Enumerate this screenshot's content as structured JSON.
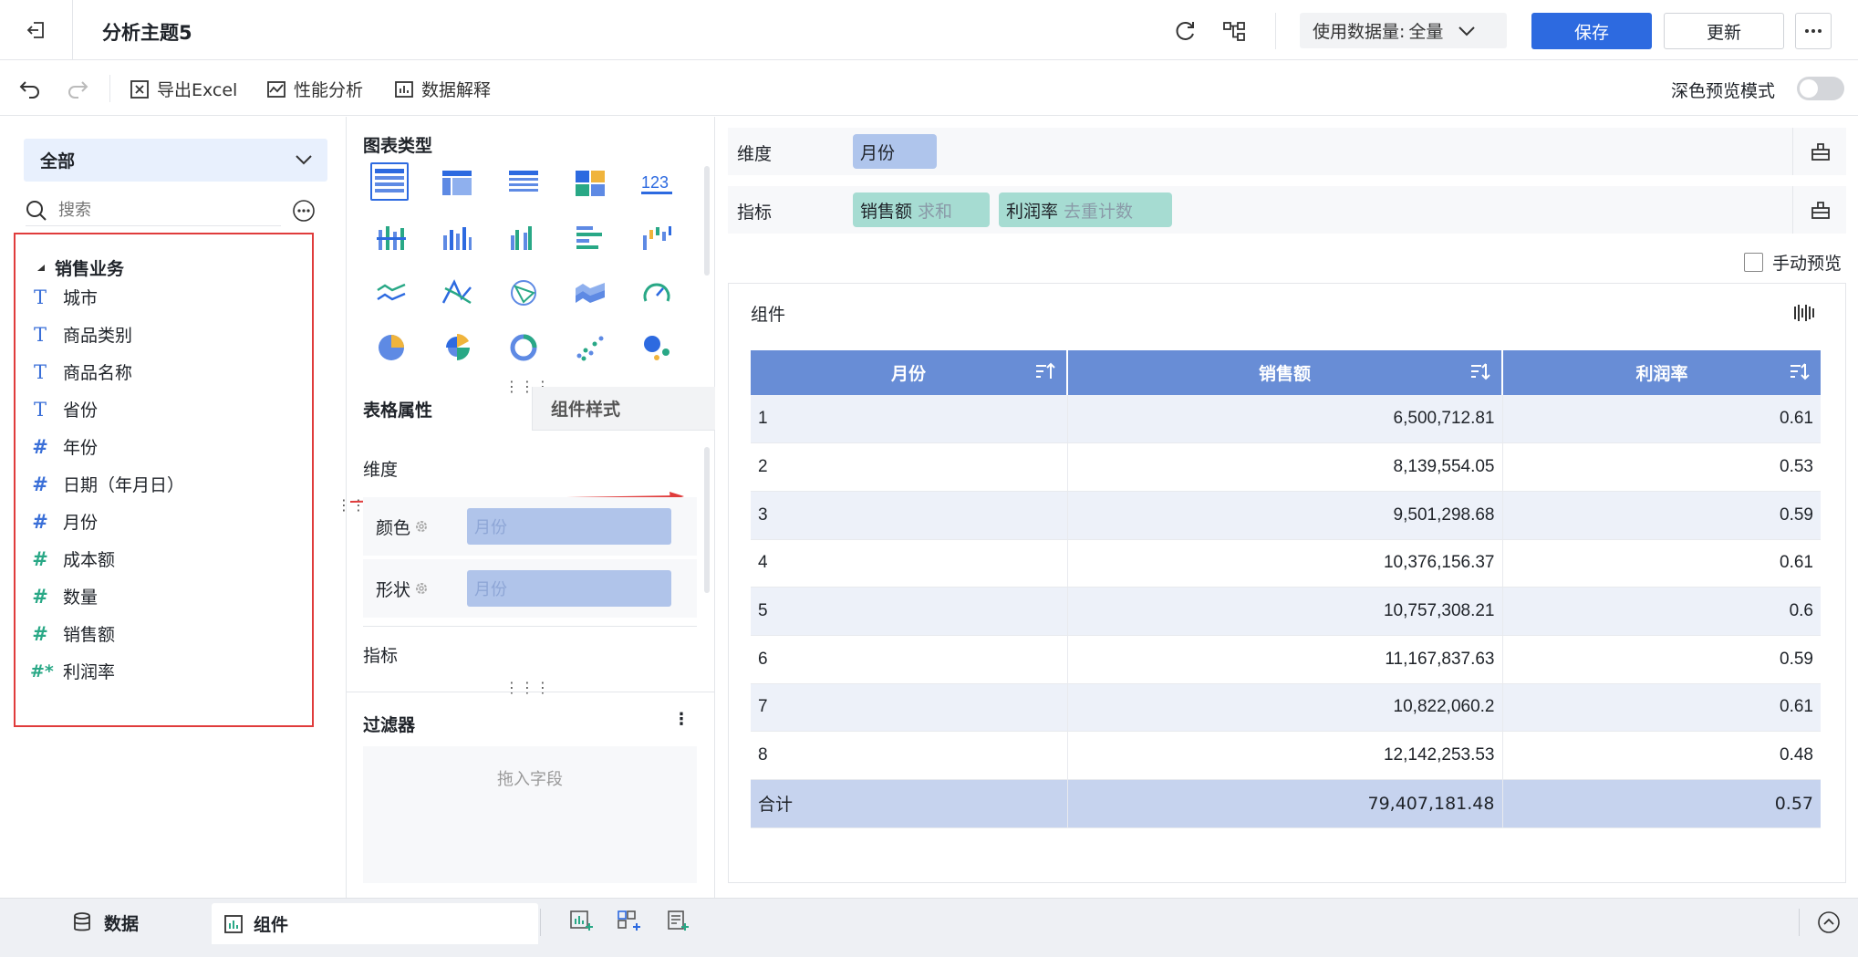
{
  "topbar": {
    "title": "分析主题5",
    "data_volume_label": "使用数据量:",
    "data_volume_value": "全量",
    "save_label": "保存",
    "update_label": "更新"
  },
  "toolbar": {
    "export_label": "导出Excel",
    "perf_label": "性能分析",
    "explain_label": "数据解释",
    "dark_mode_label": "深色预览模式",
    "dark_mode_on": false
  },
  "left": {
    "scope": "全部",
    "search_placeholder": "搜索",
    "group": "销售业务",
    "fields": [
      {
        "label": "城市",
        "type": "text",
        "icon": "text-field-icon"
      },
      {
        "label": "商品类别",
        "type": "text",
        "icon": "text-field-icon"
      },
      {
        "label": "商品名称",
        "type": "text",
        "icon": "text-field-icon"
      },
      {
        "label": "省份",
        "type": "text",
        "icon": "text-field-icon"
      },
      {
        "label": "年份",
        "type": "dim-number",
        "icon": "number-field-icon"
      },
      {
        "label": "日期（年月日）",
        "type": "dim-number",
        "icon": "number-field-icon"
      },
      {
        "label": "月份",
        "type": "dim-number",
        "icon": "number-field-icon"
      },
      {
        "label": "成本额",
        "type": "metric",
        "icon": "number-field-icon"
      },
      {
        "label": "数量",
        "type": "metric",
        "icon": "number-field-icon"
      },
      {
        "label": "销售额",
        "type": "metric",
        "icon": "number-field-icon"
      },
      {
        "label": "利润率",
        "type": "calc-metric",
        "icon": "calculated-field-icon"
      }
    ]
  },
  "middle": {
    "chart_type_title": "图表类型",
    "tab_table": "表格属性",
    "tab_style": "组件样式",
    "dimension_label": "维度",
    "color_label": "颜色",
    "color_value": "月份",
    "shape_label": "形状",
    "shape_value": "月份",
    "metric_label": "指标",
    "filter_title": "过滤器",
    "filter_placeholder": "拖入字段"
  },
  "right": {
    "dim_bar_label": "维度",
    "dim_pill": "月份",
    "metric_bar_label": "指标",
    "metric_pills": [
      {
        "name": "销售额",
        "agg": "求和"
      },
      {
        "name": "利润率",
        "agg": "去重计数"
      }
    ],
    "manual_preview_label": "手动预览",
    "widget_title": "组件"
  },
  "table": {
    "headers": [
      "月份",
      "销售额",
      "利润率"
    ],
    "rows": [
      [
        "1",
        "6,500,712.81",
        "0.61"
      ],
      [
        "2",
        "8,139,554.05",
        "0.53"
      ],
      [
        "3",
        "9,501,298.68",
        "0.59"
      ],
      [
        "4",
        "10,376,156.37",
        "0.61"
      ],
      [
        "5",
        "10,757,308.21",
        "0.6"
      ],
      [
        "6",
        "11,167,837.63",
        "0.59"
      ],
      [
        "7",
        "10,822,060.2",
        "0.61"
      ],
      [
        "8",
        "12,142,253.53",
        "0.48"
      ]
    ],
    "total": [
      "合计",
      "79,407,181.48",
      "0.57"
    ]
  },
  "bottom": {
    "data_tab": "数据",
    "component_tab": "组件"
  },
  "colors": {
    "accent": "#2d6ae0",
    "header_blue": "#688dd6",
    "highlight_red": "#e03c3c",
    "metric_green": "#29a886"
  }
}
